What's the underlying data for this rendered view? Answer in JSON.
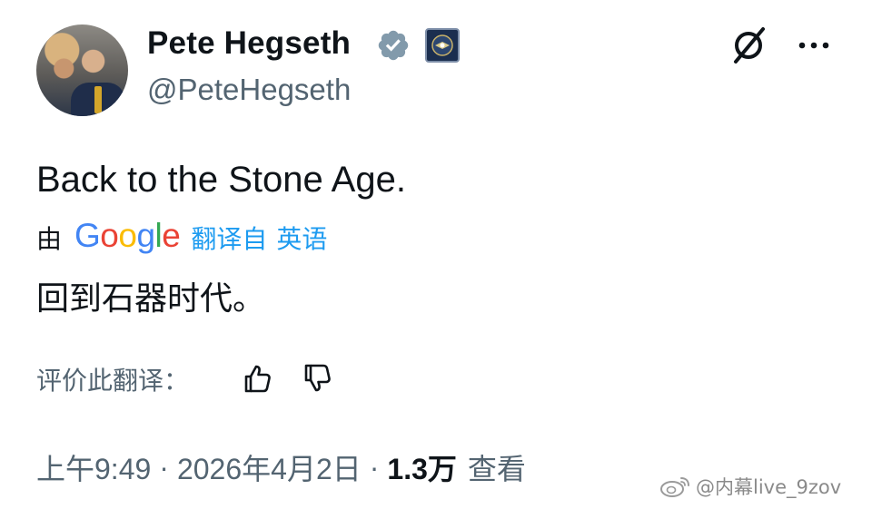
{
  "author": {
    "display_name": "Pete Hegseth",
    "handle": "@PeteHegseth",
    "verified_icon": "verified-badge-icon",
    "affiliation_icon": "department-seal-icon"
  },
  "header": {
    "grok_icon": "grok-icon",
    "more_icon": "more-options-icon"
  },
  "tweet": {
    "text": "Back to the Stone Age."
  },
  "translation": {
    "by_label": "由",
    "provider_letters": [
      "G",
      "o",
      "o",
      "g",
      "l",
      "e"
    ],
    "provider_colors": [
      "#4285F4",
      "#EA4335",
      "#FBBC05",
      "#4285F4",
      "#34A853",
      "#EA4335"
    ],
    "translated_from": "翻译自",
    "source_language": "英语",
    "translated_text": "回到石器时代。",
    "rate_label": "评价此翻译：",
    "thumbs_up_icon": "thumbs-up-icon",
    "thumbs_down_icon": "thumbs-down-icon"
  },
  "meta": {
    "time": "上午9:49",
    "separator": "·",
    "date": "2026年4月2日",
    "views_count": "1.3万",
    "views_label": "查看"
  },
  "watermark": {
    "text": "@内幕live_9zov",
    "icon": "weibo-logo-icon"
  },
  "colors": {
    "text_primary": "#0f1419",
    "text_secondary": "#536471",
    "link": "#1d9bf0",
    "verified": "#829aab"
  }
}
